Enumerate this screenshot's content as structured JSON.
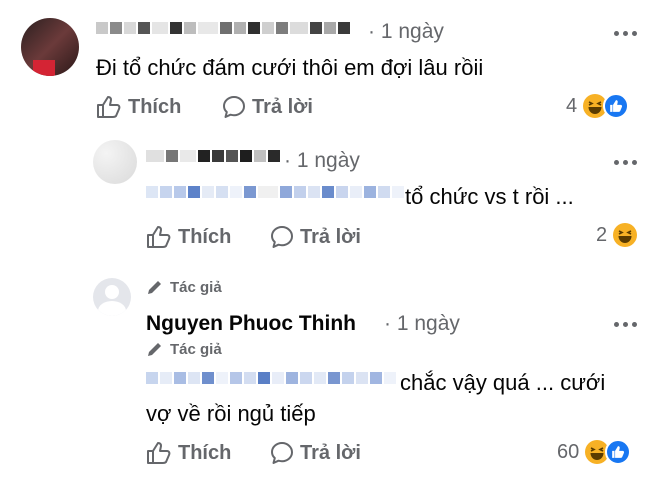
{
  "comment1": {
    "time": "· 1 ngày",
    "text": "Đi tổ chức đám cưới thôi em đợi lâu rồii",
    "like_label": "Thích",
    "reply_label": "Trả lời",
    "reaction_count": "4"
  },
  "reply1": {
    "time": "· 1 ngày",
    "text": "tổ chức vs t rồi ...",
    "like_label": "Thích",
    "reply_label": "Trả lời",
    "reaction_count": "2"
  },
  "reply2": {
    "author_badge": "Tác giả",
    "name": "Nguyen Phuoc Thinh",
    "time": "· 1 ngày",
    "mention_badge": "Tác giả",
    "text_line1": "chắc vậy quá ... cưới",
    "text_line2": "vợ về rồi ngủ tiếp",
    "like_label": "Thích",
    "reply_label": "Trả lời",
    "reaction_count": "60"
  },
  "colors": {
    "haha": "#f7b125",
    "like": "#1877f2",
    "muted": "#65676b"
  }
}
